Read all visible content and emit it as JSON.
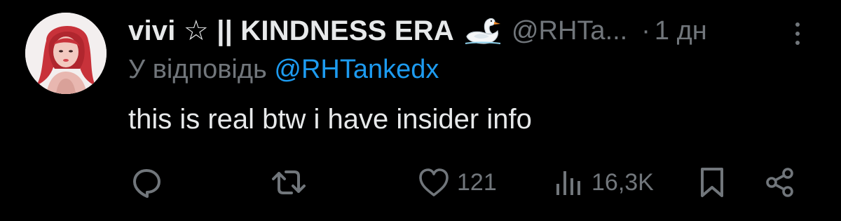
{
  "tweet": {
    "display_name": "vivi ☆ || KINDNESS ERA",
    "name_emoji": "swan-icon",
    "handle": "@RHTa...",
    "separator": "·",
    "time": "1 дн",
    "reply_prefix": "У відповідь",
    "reply_mention": "@RHTankedx",
    "text": "this is real btw i have insider info"
  },
  "actions": {
    "reply": {
      "icon": "reply-icon"
    },
    "repost": {
      "icon": "repost-icon"
    },
    "like": {
      "icon": "heart-icon",
      "count": "121"
    },
    "views": {
      "icon": "views-icon",
      "count": "16,3K"
    },
    "bookmark": {
      "icon": "bookmark-icon"
    },
    "share": {
      "icon": "share-icon"
    }
  },
  "colors": {
    "background": "#000000",
    "text_primary": "#e7e9ea",
    "text_secondary": "#71767b",
    "link": "#1d9bf0"
  }
}
